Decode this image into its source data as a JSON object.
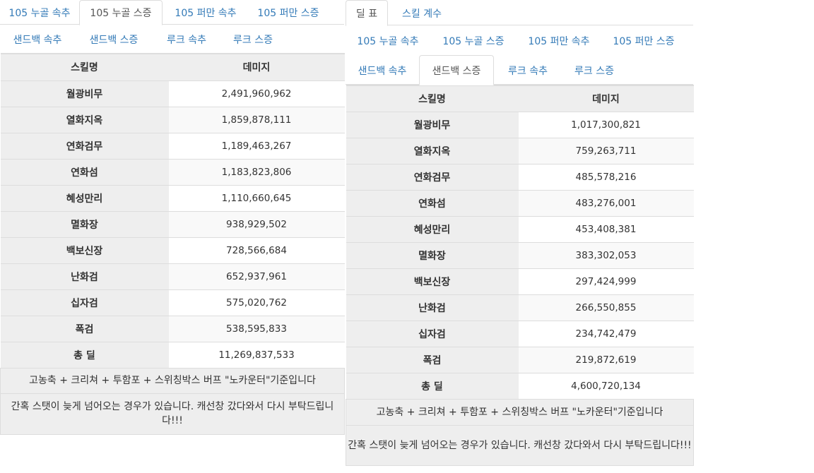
{
  "left": {
    "tabs_row1": [
      {
        "label": "105 누골 속추",
        "active": false
      },
      {
        "label": "105 누골 스증",
        "active": true
      },
      {
        "label": "105 퍼만 속추",
        "active": false
      },
      {
        "label": "105 퍼만 스증",
        "active": false
      }
    ],
    "tabs_row2": [
      {
        "label": "샌드백 속추"
      },
      {
        "label": "샌드백 스증"
      },
      {
        "label": "루크 속추"
      },
      {
        "label": "루크 스증"
      }
    ],
    "table": {
      "header_skill": "스킬명",
      "header_damage": "데미지",
      "rows": [
        {
          "skill": "월광비무",
          "damage": "2,491,960,962"
        },
        {
          "skill": "열화지옥",
          "damage": "1,859,878,111"
        },
        {
          "skill": "연화검무",
          "damage": "1,189,463,267"
        },
        {
          "skill": "연화섬",
          "damage": "1,183,823,806"
        },
        {
          "skill": "혜성만리",
          "damage": "1,110,660,645"
        },
        {
          "skill": "멸화장",
          "damage": "938,929,502"
        },
        {
          "skill": "백보신장",
          "damage": "728,566,684"
        },
        {
          "skill": "난화검",
          "damage": "652,937,961"
        },
        {
          "skill": "십자검",
          "damage": "575,020,762"
        },
        {
          "skill": "폭검",
          "damage": "538,595,833"
        },
        {
          "skill": "총 딜",
          "damage": "11,269,837,533"
        }
      ],
      "note1": "고농축 + 크리쳐 + 투함포 + 스위칭박스 버프 \"노카운터\"기준입니다",
      "note2": "간혹 스탯이 늦게 넘어오는 경우가 있습니다. 캐선창 갔다와서 다시 부탁드립니다!!!"
    }
  },
  "right": {
    "top_tabs": [
      {
        "label": "딜 표",
        "active": true
      },
      {
        "label": "스킬 계수",
        "active": false
      }
    ],
    "tabs_row1": [
      {
        "label": "105 누골 속추"
      },
      {
        "label": "105 누골 스증"
      },
      {
        "label": "105 퍼만 속추"
      },
      {
        "label": "105 퍼만 스증"
      }
    ],
    "tabs_row2": [
      {
        "label": "샌드백 속추",
        "active": false
      },
      {
        "label": "샌드백 스증",
        "active": true
      },
      {
        "label": "루크 속추",
        "active": false
      },
      {
        "label": "루크 스증",
        "active": false
      }
    ],
    "table": {
      "header_skill": "스킬명",
      "header_damage": "데미지",
      "rows": [
        {
          "skill": "월광비무",
          "damage": "1,017,300,821"
        },
        {
          "skill": "열화지옥",
          "damage": "759,263,711"
        },
        {
          "skill": "연화검무",
          "damage": "485,578,216"
        },
        {
          "skill": "연화섬",
          "damage": "483,276,001"
        },
        {
          "skill": "혜성만리",
          "damage": "453,408,381"
        },
        {
          "skill": "멸화장",
          "damage": "383,302,053"
        },
        {
          "skill": "백보신장",
          "damage": "297,424,999"
        },
        {
          "skill": "난화검",
          "damage": "266,550,855"
        },
        {
          "skill": "십자검",
          "damage": "234,742,479"
        },
        {
          "skill": "폭검",
          "damage": "219,872,619"
        },
        {
          "skill": "총 딜",
          "damage": "4,600,720,134"
        }
      ],
      "note1": "고농축 + 크리쳐 + 투함포 + 스위칭박스 버프 \"노카운터\"기준입니다",
      "note2": "간혹 스탯이 늦게 넘어오는 경우가 있습니다. 캐선창 갔다와서 다시 부탁드립니다!!!"
    }
  }
}
